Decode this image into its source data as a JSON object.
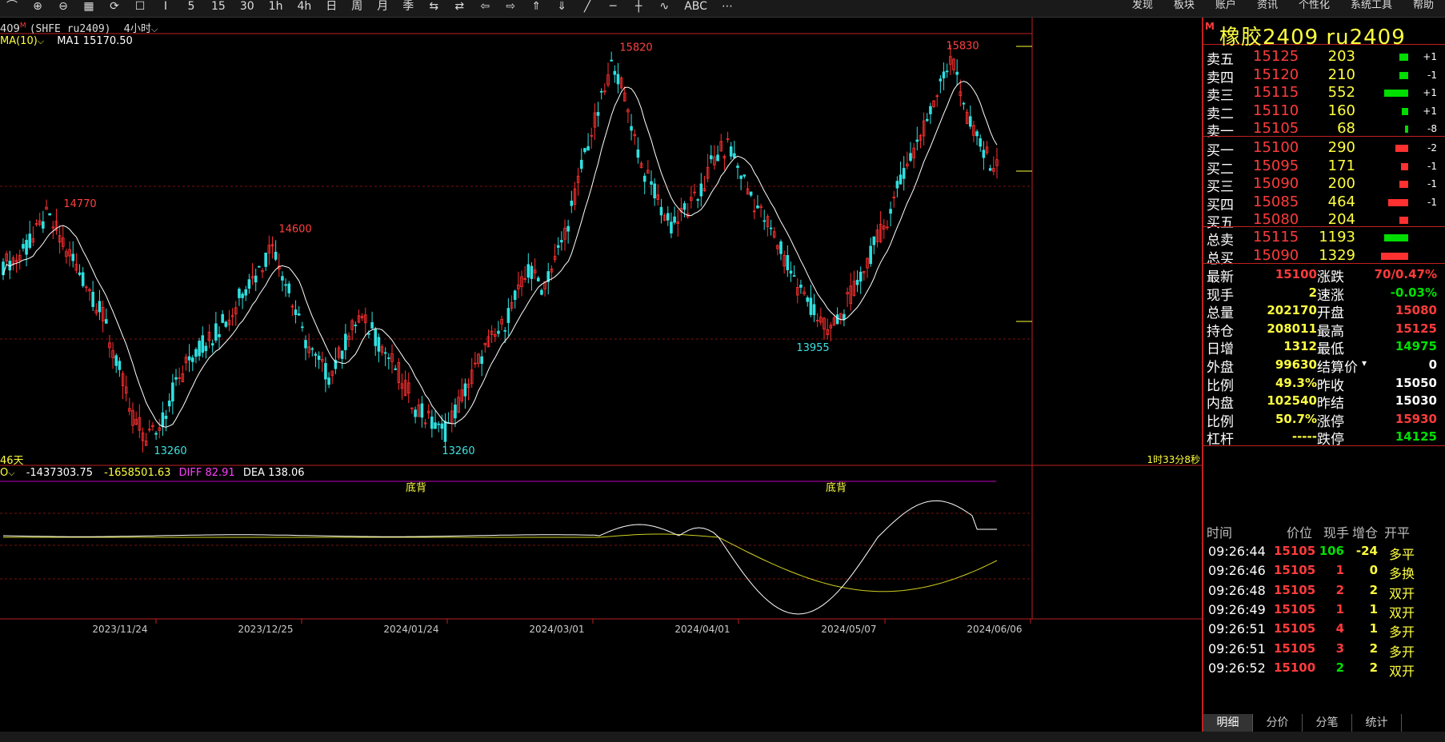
{
  "toolbar": {
    "tools": [
      "⌒",
      "⊕",
      "⊖",
      "▦",
      "⟳",
      "☐",
      "Ⅰ",
      "5",
      "15",
      "30",
      "1h",
      "4h",
      "日",
      "周",
      "月",
      "季",
      "⇆",
      "⇄",
      "⇦",
      "⇨",
      "⇑",
      "⇓",
      "╱",
      "─",
      "┼",
      "∿",
      "ABC",
      "⋯"
    ],
    "menus": [
      "发现",
      "板块",
      "账户",
      "资讯",
      "个性化",
      "系统工具",
      "帮助"
    ]
  },
  "chart": {
    "header": {
      "code_fragment": "409",
      "mark": "M",
      "contract": "(SHFE ru2409)",
      "period": "4小时",
      "dropdown": "⌵"
    },
    "ma_label": "MA(10)",
    "ma_value": "MA1 15170.50",
    "days_label": "46天",
    "countdown": "1时33分8秒",
    "macd_label": "O",
    "macd_v1": "-1437303.75",
    "macd_v2": "-1658501.63",
    "diff": "DIFF 82.91",
    "dea": "DEA 138.06",
    "annotations": [
      {
        "text": "14770",
        "color": "#ff4040"
      },
      {
        "text": "14600",
        "color": "#ff4040"
      },
      {
        "text": "15820",
        "color": "#ff4040"
      },
      {
        "text": "15830",
        "color": "#ff4040"
      },
      {
        "text": "13260",
        "color": "#40e0e0"
      },
      {
        "text": "13260",
        "color": "#40e0e0"
      },
      {
        "text": "13955",
        "color": "#40e0e0"
      }
    ],
    "signals": [
      "底背",
      "底背"
    ],
    "dates": [
      "2023/11/24",
      "2023/12/25",
      "2024/01/24",
      "2024/03/01",
      "2024/04/01",
      "2024/05/07",
      "2024/06/06"
    ]
  },
  "chart_data": {
    "type": "candlestick",
    "title": "橡胶2409 ru2409",
    "period": "4小时",
    "indicators": [
      "MA(10)",
      "MACD"
    ],
    "ylim": [
      13100,
      16000
    ],
    "x_labels": [
      "2023/11/24",
      "2023/12/25",
      "2024/01/24",
      "2024/03/01",
      "2024/04/01",
      "2024/05/07",
      "2024/06/06"
    ],
    "pivot_labels": [
      {
        "label": "14770",
        "value": 14770,
        "kind": "high"
      },
      {
        "label": "14600",
        "value": 14600,
        "kind": "high"
      },
      {
        "label": "15820",
        "value": 15820,
        "kind": "high"
      },
      {
        "label": "15830",
        "value": 15830,
        "kind": "high"
      },
      {
        "label": "13260",
        "value": 13260,
        "kind": "low"
      },
      {
        "label": "13260",
        "value": 13260,
        "kind": "low"
      },
      {
        "label": "13955",
        "value": 13955,
        "kind": "low"
      }
    ],
    "close_path": [
      14450,
      14500,
      14600,
      14770,
      14650,
      14450,
      14300,
      14100,
      13800,
      13450,
      13300,
      13350,
      13600,
      13800,
      13900,
      14000,
      14100,
      14300,
      14400,
      14600,
      14300,
      14000,
      13800,
      13700,
      13900,
      14100,
      14000,
      13850,
      13700,
      13500,
      13400,
      13300,
      13500,
      13700,
      13900,
      14000,
      14200,
      14400,
      14300,
      14500,
      14800,
      15200,
      15500,
      15820,
      15500,
      15100,
      14900,
      14700,
      14800,
      14900,
      15150,
      15250,
      15050,
      14850,
      14700,
      14500,
      14300,
      14150,
      14000,
      14100,
      14300,
      14500,
      14700,
      14950,
      15200,
      15400,
      15700,
      15830,
      15400,
      15200,
      15100
    ],
    "ma_last": 15170.5,
    "macd": {
      "diff": 82.91,
      "dea": 138.06
    }
  },
  "panel": {
    "mark": "M",
    "name": "橡胶2409  ru2409",
    "asks": [
      {
        "label": "卖五",
        "price": "15125",
        "vol": "203",
        "chg": "+1",
        "bar": 0.18,
        "color": "#00dd00"
      },
      {
        "label": "卖四",
        "price": "15120",
        "vol": "210",
        "chg": "-1",
        "bar": 0.19,
        "color": "#00dd00"
      },
      {
        "label": "卖三",
        "price": "15115",
        "vol": "552",
        "chg": "+1",
        "bar": 0.5,
        "color": "#00dd00"
      },
      {
        "label": "卖二",
        "price": "15110",
        "vol": "160",
        "chg": "+1",
        "bar": 0.14,
        "color": "#00dd00"
      },
      {
        "label": "卖一",
        "price": "15105",
        "vol": "68",
        "chg": "-8",
        "bar": 0.06,
        "color": "#00dd00"
      }
    ],
    "bids": [
      {
        "label": "买一",
        "price": "15100",
        "vol": "290",
        "chg": "-2",
        "bar": 0.26,
        "color": "#ff3030"
      },
      {
        "label": "买二",
        "price": "15095",
        "vol": "171",
        "chg": "-1",
        "bar": 0.15,
        "color": "#ff3030"
      },
      {
        "label": "买三",
        "price": "15090",
        "vol": "200",
        "chg": "-1",
        "bar": 0.18,
        "color": "#ff3030"
      },
      {
        "label": "买四",
        "price": "15085",
        "vol": "464",
        "chg": "-1",
        "bar": 0.42,
        "color": "#ff3030"
      },
      {
        "label": "买五",
        "price": "15080",
        "vol": "204",
        "chg": "",
        "bar": 0.18,
        "color": "#ff3030"
      }
    ],
    "totals": [
      {
        "label": "总卖",
        "price": "15115",
        "vol": "1193",
        "bar": 0.5,
        "color": "#00dd00"
      },
      {
        "label": "总买",
        "price": "15090",
        "vol": "1329",
        "bar": 0.56,
        "color": "#ff3030"
      }
    ],
    "stats": [
      {
        "l1": "最新",
        "v1": "15100",
        "c1": "#ff3b3b",
        "l2": "涨跌",
        "v2": "70/0.47%",
        "c2": "#ff3b3b"
      },
      {
        "l1": "现手",
        "v1": "2",
        "c1": "#ffff40",
        "l2": "速涨",
        "v2": "-0.03%",
        "c2": "#00e000"
      },
      {
        "l1": "总量",
        "v1": "202170",
        "c1": "#ffff40",
        "l2": "开盘",
        "v2": "15080",
        "c2": "#ff3b3b"
      },
      {
        "l1": "持仓",
        "v1": "208011",
        "c1": "#ffff40",
        "l2": "最高",
        "v2": "15125",
        "c2": "#ff3b3b"
      },
      {
        "l1": "日增",
        "v1": "1312",
        "c1": "#ffff40",
        "l2": "最低",
        "v2": "14975",
        "c2": "#00e000"
      },
      {
        "l1": "外盘",
        "v1": "99630",
        "c1": "#ffff40",
        "l2": "结算价",
        "v2": "0",
        "c2": "#fff"
      },
      {
        "l1": "比例",
        "v1": "49.3%",
        "c1": "#ffff40",
        "l2": "昨收",
        "v2": "15050",
        "c2": "#fff"
      },
      {
        "l1": "内盘",
        "v1": "102540",
        "c1": "#ffff40",
        "l2": "昨结",
        "v2": "15030",
        "c2": "#fff"
      },
      {
        "l1": "比例",
        "v1": "50.7%",
        "c1": "#ffff40",
        "l2": "涨停",
        "v2": "15930",
        "c2": "#ff3b3b"
      },
      {
        "l1": "杠杆",
        "v1": "-----",
        "c1": "#ffff40",
        "l2": "跌停",
        "v2": "14125",
        "c2": "#00e000"
      }
    ],
    "settle_dropdown": "▾",
    "tick_head": [
      "时间",
      "价位",
      "现手",
      "增仓",
      "开平"
    ],
    "ticks": [
      {
        "time": "09:26:44",
        "price": "15105",
        "vol": "106",
        "oi": "-24",
        "type": "多平",
        "vc": "#00e000"
      },
      {
        "time": "09:26:46",
        "price": "15105",
        "vol": "1",
        "oi": "0",
        "type": "多换",
        "vc": "#ff3b3b"
      },
      {
        "time": "09:26:48",
        "price": "15105",
        "vol": "2",
        "oi": "2",
        "type": "双开",
        "vc": "#ff3b3b"
      },
      {
        "time": "09:26:49",
        "price": "15105",
        "vol": "1",
        "oi": "1",
        "type": "双开",
        "vc": "#ff3b3b"
      },
      {
        "time": "09:26:51",
        "price": "15105",
        "vol": "4",
        "oi": "1",
        "type": "多开",
        "vc": "#ff3b3b"
      },
      {
        "time": "09:26:51",
        "price": "15105",
        "vol": "3",
        "oi": "2",
        "type": "多开",
        "vc": "#ff3b3b"
      },
      {
        "time": "09:26:52",
        "price": "15100",
        "vol": "2",
        "oi": "2",
        "type": "双开",
        "vc": "#00e000"
      }
    ],
    "tabs": [
      "明细",
      "分价",
      "分笔",
      "统计"
    ]
  }
}
